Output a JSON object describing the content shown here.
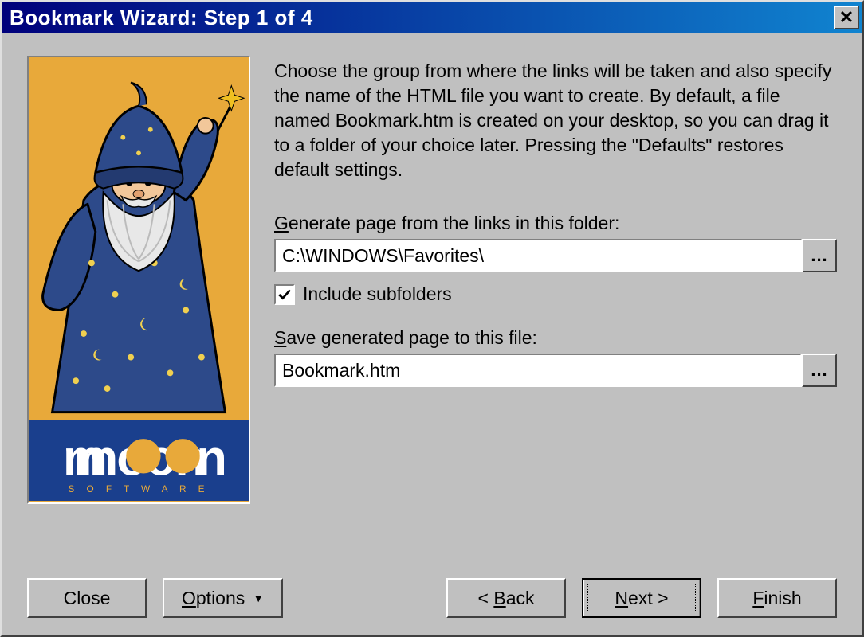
{
  "title": "Bookmark Wizard: Step 1 of 4",
  "description": "Choose the group from where the links will be taken and also specify the name of the HTML file you want to create. By default, a file named Bookmark.htm is created on your desktop, so you can drag it to a folder of your choice later. Pressing the \"Defaults\" restores default settings.",
  "fields": {
    "folder_label_pre": "G",
    "folder_label_rest": "enerate page from the links in this folder:",
    "folder_value": "C:\\WINDOWS\\Favorites\\",
    "include_subfolders_label": "Include subfolders",
    "include_subfolders_checked": true,
    "save_label_pre": "S",
    "save_label_rest": "ave generated page to this file:",
    "save_value": "Bookmark.htm",
    "browse_label": "..."
  },
  "buttons": {
    "close": "Close",
    "options_pre": "O",
    "options_rest": "ptions",
    "back_pre": "B",
    "back_rest": "ack",
    "next_pre": "N",
    "next_rest": "ext",
    "finish_pre": "F",
    "finish_rest": "inish"
  },
  "brand": {
    "name": "moon",
    "subtitle": "S O F T W A R E"
  }
}
